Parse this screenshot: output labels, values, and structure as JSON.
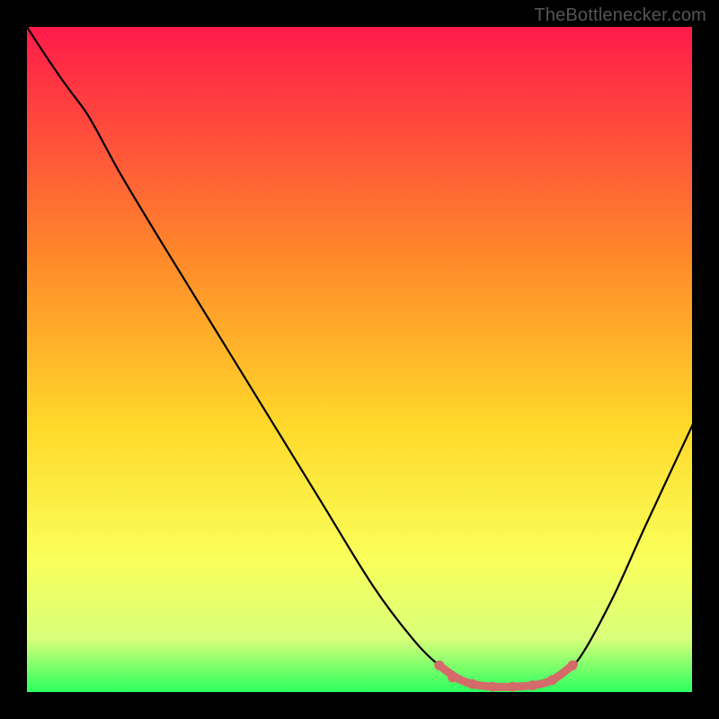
{
  "watermark": "TheBottlenecker.com",
  "chart_data": {
    "type": "line",
    "title": "",
    "xlabel": "",
    "ylabel": "",
    "xlim": [
      0,
      100
    ],
    "ylim": [
      0,
      100
    ],
    "gradient_stops": [
      {
        "offset": 0,
        "color": "#ff1a4a"
      },
      {
        "offset": 35,
        "color": "#ff8a2a"
      },
      {
        "offset": 60,
        "color": "#ffd92a"
      },
      {
        "offset": 80,
        "color": "#faff5a"
      },
      {
        "offset": 92,
        "color": "#d8ff7a"
      },
      {
        "offset": 100,
        "color": "#2bff5e"
      }
    ],
    "series": [
      {
        "name": "bottleneck-curve",
        "color": "#000000",
        "points": [
          {
            "x": 0,
            "y": 100
          },
          {
            "x": 5,
            "y": 92
          },
          {
            "x": 9,
            "y": 87
          },
          {
            "x": 14,
            "y": 78
          },
          {
            "x": 20,
            "y": 68
          },
          {
            "x": 28,
            "y": 55
          },
          {
            "x": 36,
            "y": 42
          },
          {
            "x": 44,
            "y": 29
          },
          {
            "x": 52,
            "y": 16
          },
          {
            "x": 58,
            "y": 8
          },
          {
            "x": 62,
            "y": 4
          },
          {
            "x": 66,
            "y": 1.5
          },
          {
            "x": 70,
            "y": 0.8
          },
          {
            "x": 75,
            "y": 0.8
          },
          {
            "x": 79,
            "y": 1.5
          },
          {
            "x": 83,
            "y": 5
          },
          {
            "x": 88,
            "y": 14
          },
          {
            "x": 93,
            "y": 25
          },
          {
            "x": 100,
            "y": 40
          }
        ]
      },
      {
        "name": "optimal-marker",
        "color": "#d46a6a",
        "thick": true,
        "points": [
          {
            "x": 62,
            "y": 4
          },
          {
            "x": 64,
            "y": 2.2
          },
          {
            "x": 67,
            "y": 1.2
          },
          {
            "x": 70,
            "y": 0.8
          },
          {
            "x": 73,
            "y": 0.8
          },
          {
            "x": 76,
            "y": 1.0
          },
          {
            "x": 79,
            "y": 1.8
          },
          {
            "x": 82,
            "y": 4
          }
        ]
      }
    ]
  }
}
